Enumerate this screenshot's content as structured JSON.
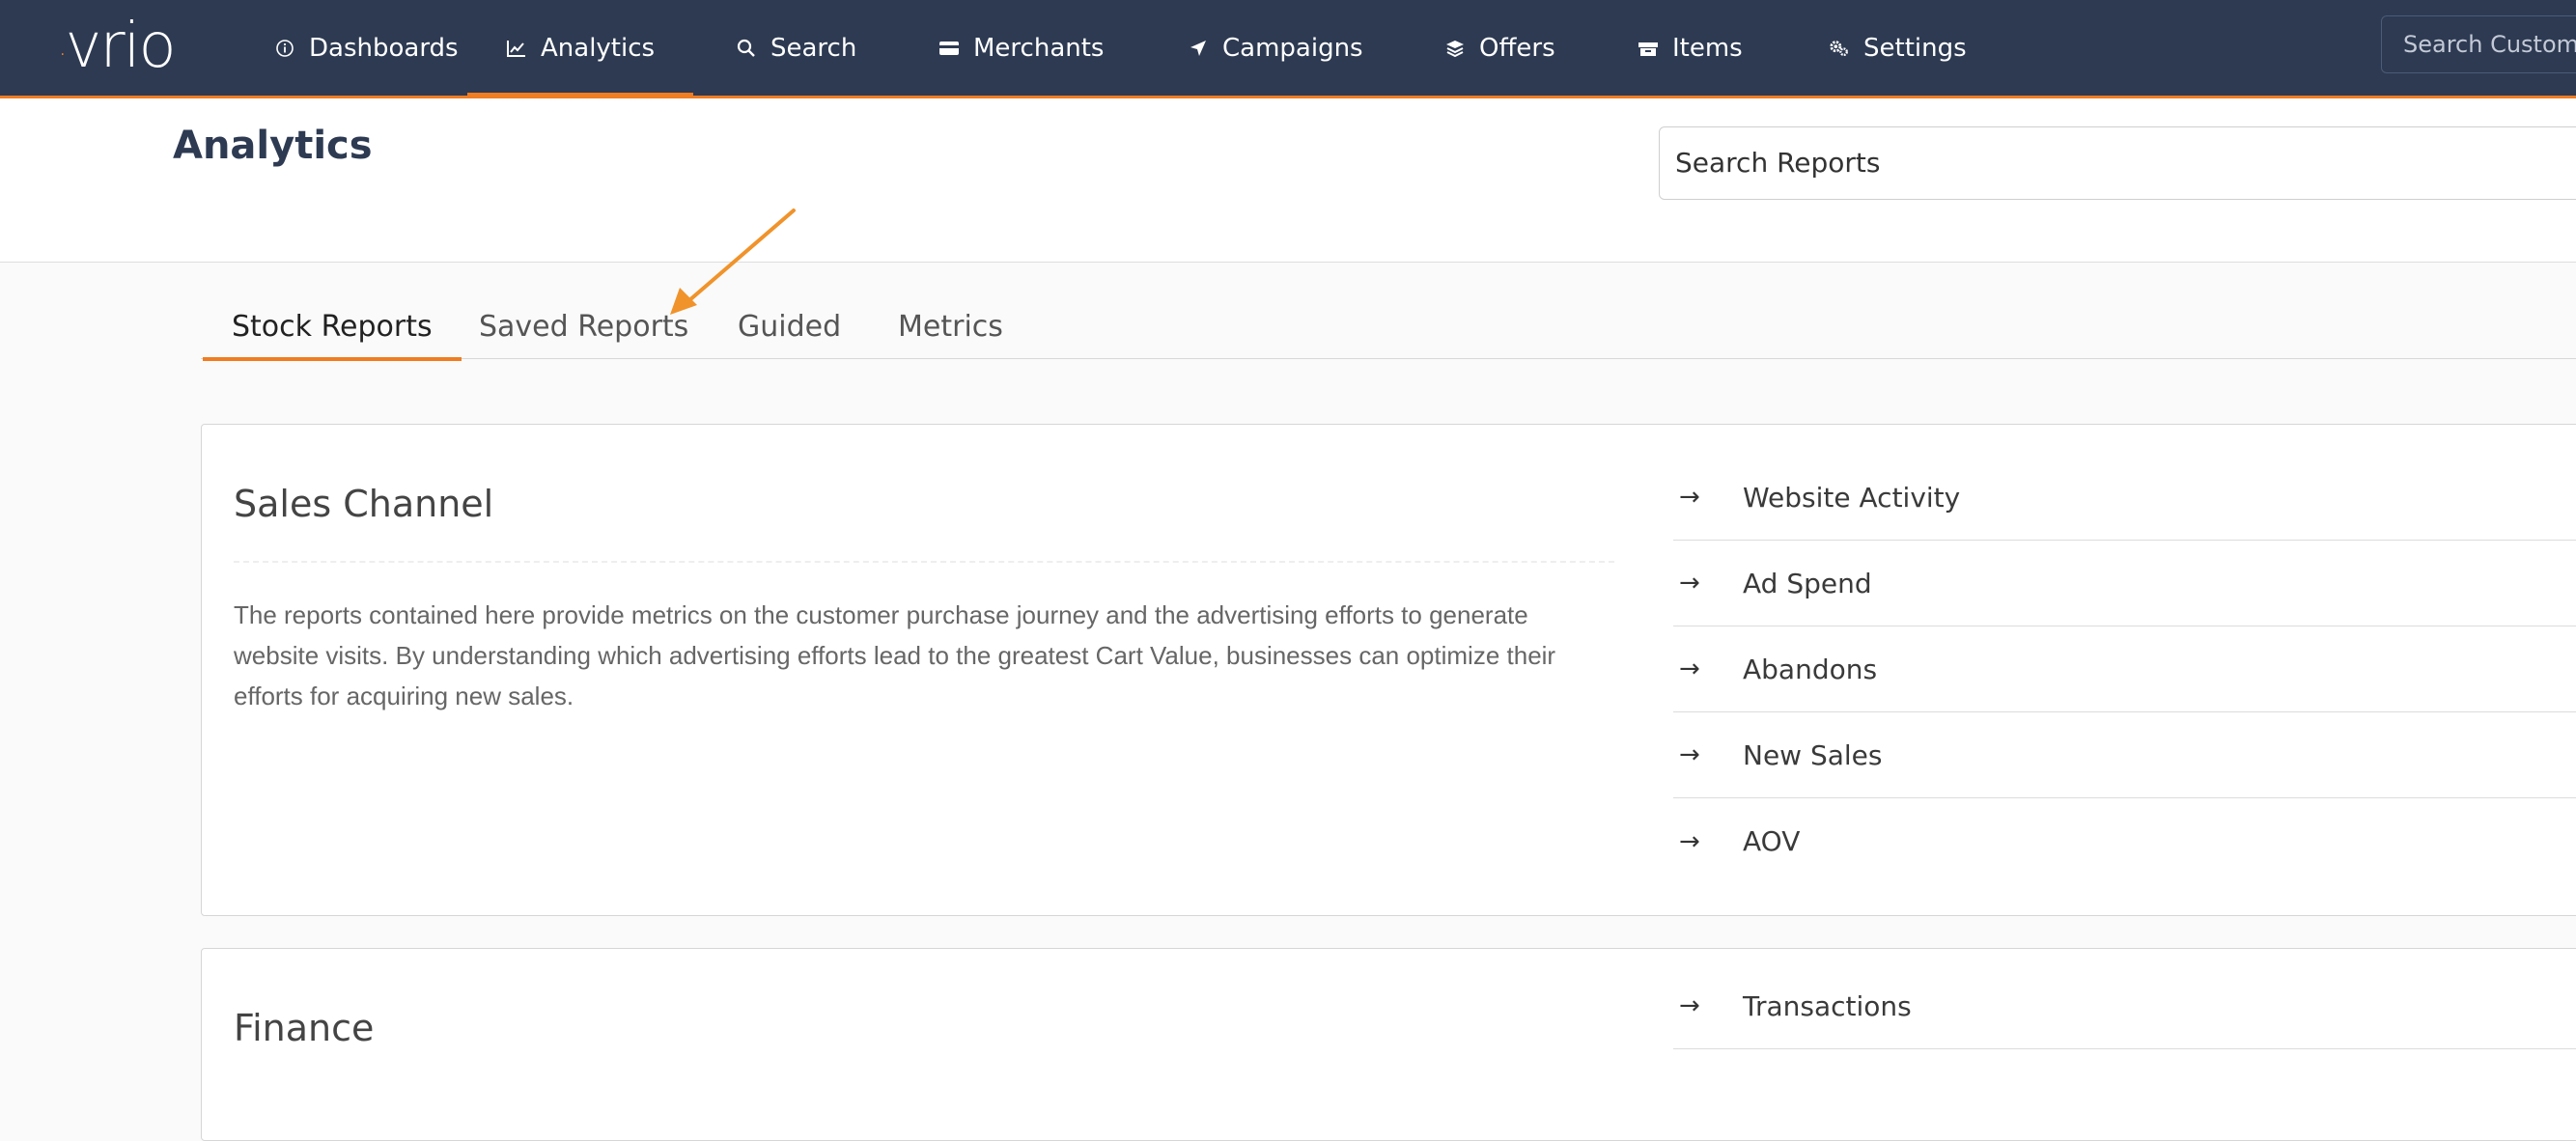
{
  "topbar": {
    "logo": "vrio",
    "nav": [
      {
        "label": "Dashboards",
        "icon": "info-circle-icon"
      },
      {
        "label": "Analytics",
        "icon": "line-chart-icon",
        "active": true
      },
      {
        "label": "Search",
        "icon": "search-icon"
      },
      {
        "label": "Merchants",
        "icon": "credit-card-icon"
      },
      {
        "label": "Campaigns",
        "icon": "paper-plane-icon"
      },
      {
        "label": "Offers",
        "icon": "layers-icon"
      },
      {
        "label": "Items",
        "icon": "box-icon"
      },
      {
        "label": "Settings",
        "icon": "gears-icon"
      }
    ],
    "search_placeholder": "Search Custome",
    "accent": "#ef7d22",
    "bg": "#2d3a52"
  },
  "header": {
    "title": "Analytics",
    "search_placeholder": "Search Reports"
  },
  "tabs": [
    {
      "label": "Stock Reports",
      "active": true
    },
    {
      "label": "Saved Reports"
    },
    {
      "label": "Guided"
    },
    {
      "label": "Metrics"
    }
  ],
  "sections": [
    {
      "title": "Sales Channel",
      "description": "The reports contained here provide metrics on the customer purchase journey and the advertising efforts to generate website visits. By understanding which advertising efforts lead to the greatest Cart Value, businesses can optimize their efforts for acquiring new sales.",
      "links": [
        "Website Activity",
        "Ad Spend",
        "Abandons",
        "New Sales",
        "AOV"
      ]
    },
    {
      "title": "Finance",
      "description": "",
      "links": [
        "Transactions"
      ]
    }
  ],
  "link_arrow": "→"
}
